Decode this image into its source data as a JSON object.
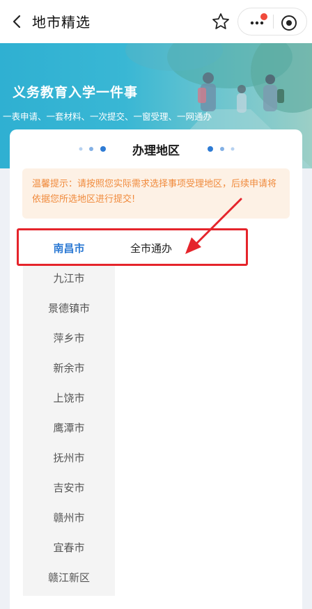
{
  "topbar": {
    "title": "地市精选",
    "back_icon": "chevron-left-icon",
    "favorite_icon": "star-icon",
    "more_icon": "more-dots-icon",
    "record_icon": "record-icon",
    "notification_dot_color": "#f04a3c"
  },
  "hero": {
    "title": "义务教育入学一件事",
    "subtitle": "一表申请、一套材料、一次提交、一窗受理、一网通办"
  },
  "card": {
    "title": "办理地区",
    "accent_color": "#2e7bd4",
    "notice": "温馨提示：请按照您实际需求选择事项受理地区，后续申请将依据您所选地区进行提交!"
  },
  "regions": [
    {
      "label": "南昌市",
      "active": true
    },
    {
      "label": "九江市",
      "active": false
    },
    {
      "label": "景德镇市",
      "active": false
    },
    {
      "label": "萍乡市",
      "active": false
    },
    {
      "label": "新余市",
      "active": false
    },
    {
      "label": "上饶市",
      "active": false
    },
    {
      "label": "鹰潭市",
      "active": false
    },
    {
      "label": "抚州市",
      "active": false
    },
    {
      "label": "吉安市",
      "active": false
    },
    {
      "label": "赣州市",
      "active": false
    },
    {
      "label": "宜春市",
      "active": false
    },
    {
      "label": "赣江新区",
      "active": false
    }
  ],
  "sub_options": [
    {
      "label": "全市通办"
    }
  ],
  "annotation": {
    "color": "#e5242b"
  }
}
